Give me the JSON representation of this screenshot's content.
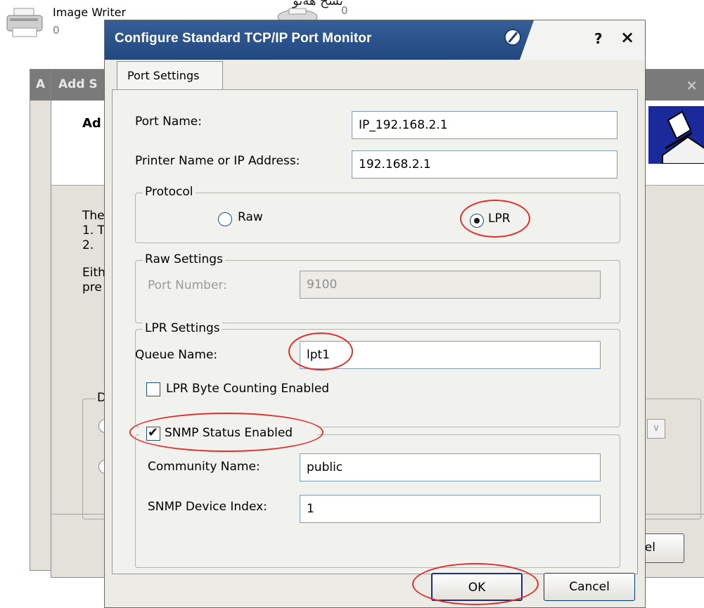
{
  "top_label": "تسح هةتو",
  "desktop": {
    "printer1": {
      "name": "Image Writer",
      "count": "0"
    },
    "printer2": {
      "count": "0"
    }
  },
  "background_windows": {
    "back_title": "A",
    "front_title": "Add S",
    "heading": "Ad",
    "body_lines": [
      "The",
      "1. T",
      "2.",
      "Eith",
      "pre"
    ],
    "group_letter": "D",
    "cancel_fragment": "ncel"
  },
  "dialog": {
    "title": "Configure Standard TCP/IP Port Monitor",
    "help_glyph": "?",
    "close_glyph": "×",
    "tab": "Port Settings",
    "port_name_label": "Port Name:",
    "port_name_value": "IP_192.168.2.1",
    "address_label": "Printer Name or IP Address:",
    "address_value": "192.168.2.1",
    "protocol": {
      "legend": "Protocol",
      "raw_label": "Raw",
      "lpr_label": "LPR",
      "selected": "LPR"
    },
    "raw_settings": {
      "legend": "Raw Settings",
      "port_number_label": "Port Number:",
      "port_number_value": "9100"
    },
    "lpr_settings": {
      "legend": "LPR Settings",
      "queue_label": "Queue Name:",
      "queue_value": "lpt1",
      "byte_counting_label": "LPR Byte Counting Enabled",
      "byte_counting_checked": false
    },
    "snmp": {
      "label": "SNMP Status Enabled",
      "checked": true,
      "community_label": "Community Name:",
      "community_value": "public",
      "device_index_label": "SNMP Device Index:",
      "device_index_value": "1"
    },
    "ok_label": "OK",
    "cancel_label": "Cancel"
  },
  "colors": {
    "titlebar": "#2b528b",
    "annotation": "#e03030",
    "window_bg": "#ecebe6"
  }
}
